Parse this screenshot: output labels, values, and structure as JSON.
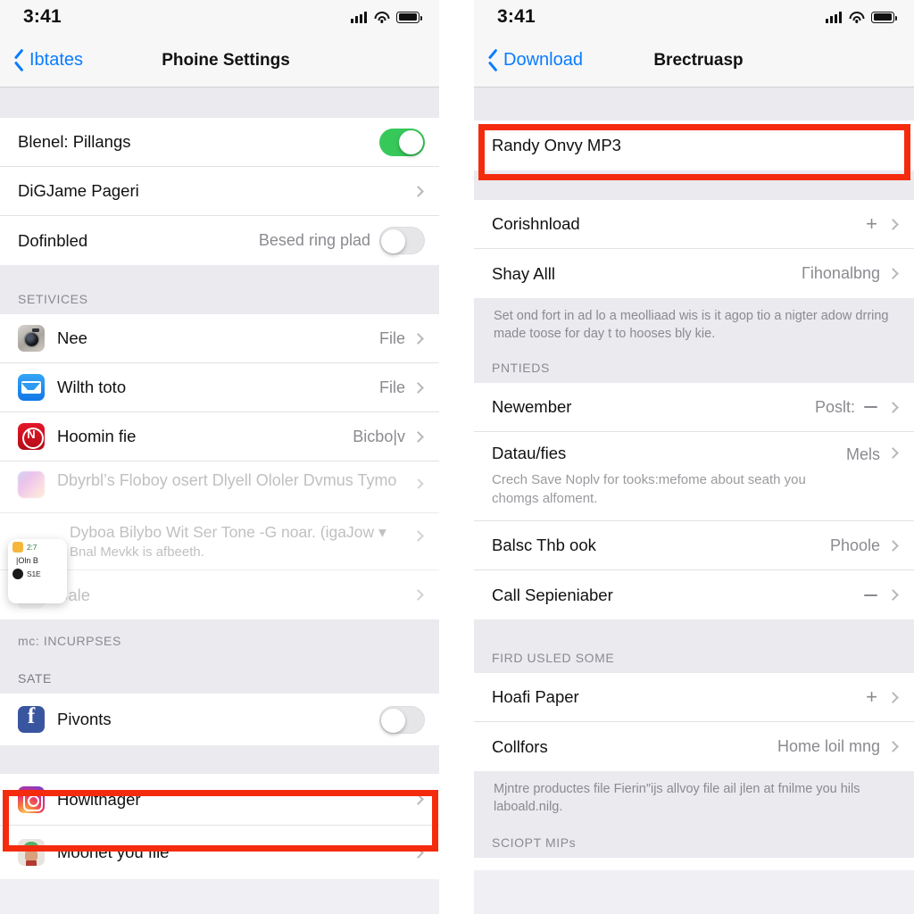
{
  "meta": {
    "accent_blue": "#0a7cff",
    "highlight_red": "#f52b0e",
    "toggle_green": "#37c85a"
  },
  "left_phone": {
    "status": {
      "time": "3:41",
      "signal_icon": "cellular-bars-icon",
      "wifi_icon": "wifi-icon",
      "battery_icon": "battery-full-icon"
    },
    "nav": {
      "back_label": "Ibtates",
      "title": "Phoine Settings"
    },
    "group_1": [
      {
        "title": "Blenel: Pillangs",
        "control": "toggle",
        "state": "on"
      },
      {
        "title": "DiGJame Pageri",
        "control": "chevron"
      },
      {
        "title": "Dofinbled",
        "value": "Besed ring plad",
        "control": "toggle",
        "state": "off"
      }
    ],
    "services_header": "SETIVICES",
    "services": [
      {
        "icon": "camera-app-icon",
        "title": "Nee",
        "value": "File"
      },
      {
        "icon": "mail-app-icon",
        "title": "Wilth toto",
        "value": "File"
      },
      {
        "icon": "red-app-icon",
        "title": "Hoomin fie",
        "value": "Bicbo|v"
      },
      {
        "icon": "music-app-icon",
        "title": "Dbyrbl’s Floboy osert Dlyell Ololer Dvmus Tymo",
        "value": ""
      },
      {
        "icon": "popup-card-icon",
        "title": "Dyboa Bilybo Wit Ser Tone -G noar. (igaJow ▾",
        "subtitle": "Bnal Mevkk is afbeeth."
      },
      {
        "icon": "doc-app-icon",
        "title": "Bale",
        "value": ""
      }
    ],
    "incurses_header": "mc: INCURPSES",
    "sate_header": "SATE",
    "social": [
      {
        "icon": "facebook-app-icon",
        "title": "Pivonts",
        "control": "toggle",
        "state": "off"
      }
    ],
    "highlighted": {
      "icon": "instagram-app-icon",
      "title": "Howlthager"
    },
    "last_row": {
      "icon": "avatar-app-icon",
      "title": "Moonet you file"
    },
    "popup_card": {
      "line_1a": "2:7",
      "line_2": "|Oln B",
      "line_3": "S1E"
    }
  },
  "right_phone": {
    "status": {
      "time": "3:41",
      "signal_icon": "cellular-bars-icon",
      "wifi_icon": "wifi-icon",
      "battery_icon": "battery-full-icon"
    },
    "nav": {
      "back_label": "Download",
      "title": "Brectruasp"
    },
    "highlighted": {
      "title": "Randy Onvy MP3"
    },
    "group_1": [
      {
        "title": "Corishnload",
        "value": "",
        "has_plus": true
      },
      {
        "title": "Shay Alll",
        "value": "Γihonalbng",
        "has_plus": false
      }
    ],
    "footer_1": "Set ond fort in ad lo a meolliaad wis is it agop tio a nigter adow drring made toose for day t to hooses bly kie.",
    "pntieds_header": "PNTIEDS",
    "group_2": [
      {
        "title": "Newember",
        "value": "Poslt:",
        "has_minus": true
      },
      {
        "title": "Datau/fies",
        "value": "Mels",
        "subtitle": "Crech Save Noplv for tooks:mefome about seath you chomgs alfoment."
      },
      {
        "title": "Balsc Thb ook",
        "value": "Phoole"
      },
      {
        "title": "Call Sepieniaber",
        "value": "",
        "has_minus": true
      }
    ],
    "first_used_header": "FIRD USLED SOME",
    "group_3": [
      {
        "title": "Hoafi Paper",
        "value": "",
        "has_plus": true
      },
      {
        "title": "Collfors",
        "value": "Home loil mng"
      }
    ],
    "footer_2": "Mjntre productes file Fierin″ijs allvoy file ail jlen at fnilme you hils laboald.nilg.",
    "sciopt_header": "SCIOPT MIPs"
  }
}
